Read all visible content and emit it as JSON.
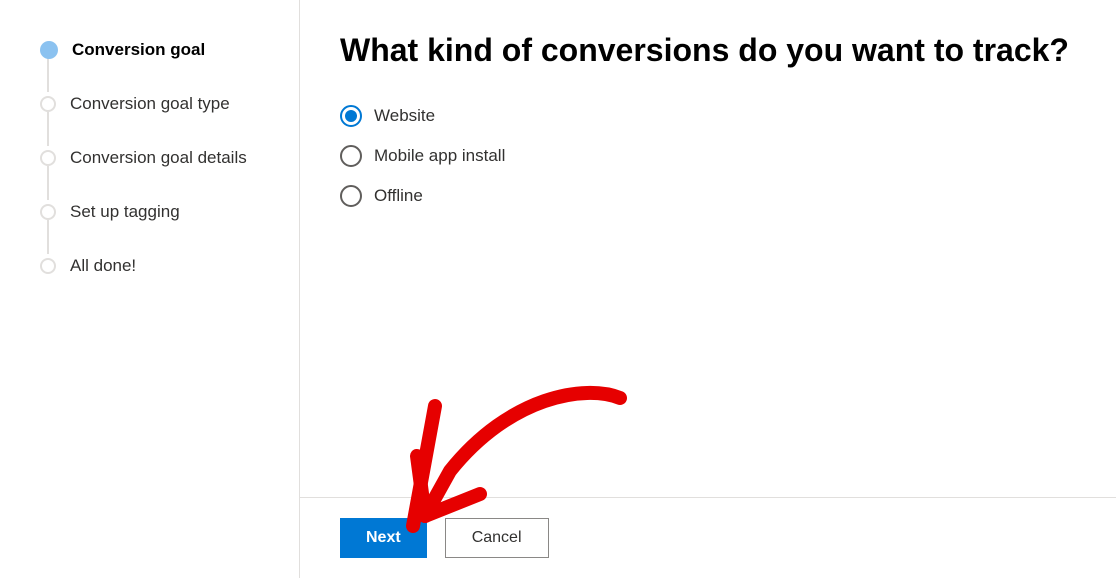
{
  "sidebar": {
    "steps": [
      {
        "label": "Conversion goal",
        "active": true
      },
      {
        "label": "Conversion goal type",
        "active": false
      },
      {
        "label": "Conversion goal details",
        "active": false
      },
      {
        "label": "Set up tagging",
        "active": false
      },
      {
        "label": "All done!",
        "active": false
      }
    ]
  },
  "main": {
    "heading": "What kind of conversions do you want to track?",
    "options": [
      {
        "label": "Website",
        "selected": true
      },
      {
        "label": "Mobile app install",
        "selected": false
      },
      {
        "label": "Offline",
        "selected": false
      }
    ]
  },
  "footer": {
    "next_label": "Next",
    "cancel_label": "Cancel"
  },
  "colors": {
    "primary": "#0078d4",
    "annotation": "#e60000"
  }
}
